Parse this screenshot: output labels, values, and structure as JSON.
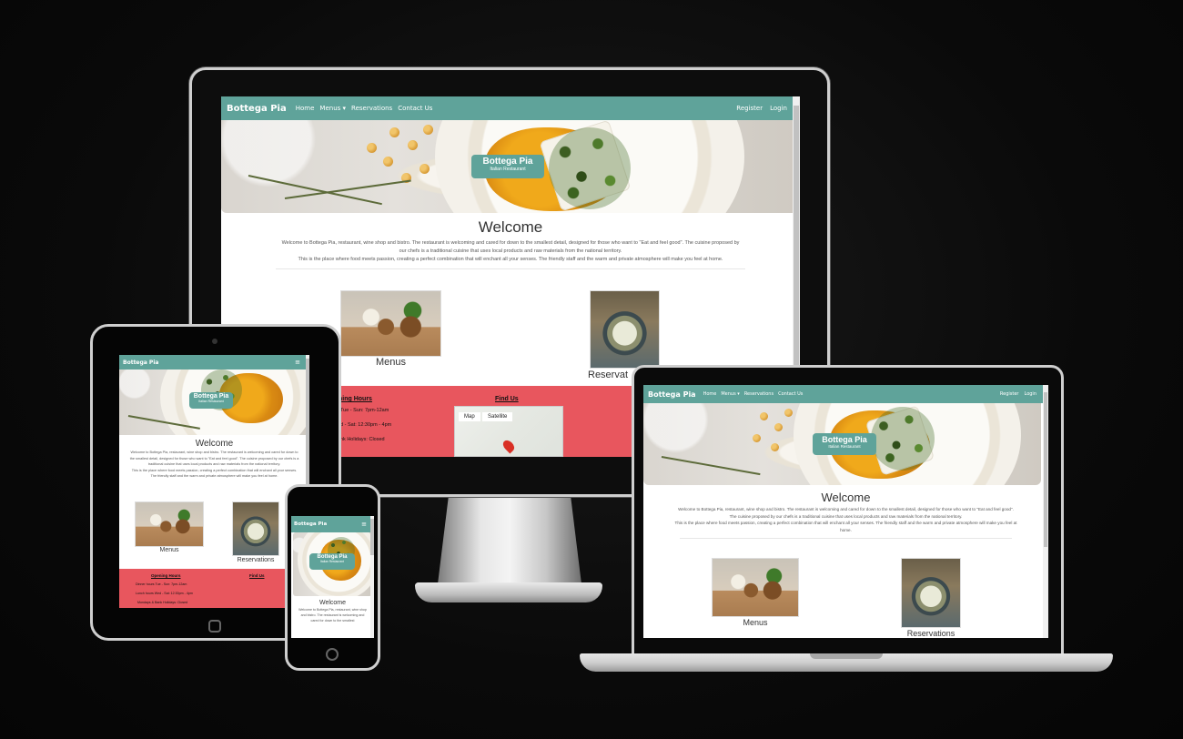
{
  "site": {
    "brand": "Bottega Pia",
    "nav": [
      "Home",
      "Menus",
      "Reservations",
      "Contact Us"
    ],
    "nav_right": [
      "Register",
      "Login"
    ],
    "hero": {
      "title": "Bottega Pia",
      "subtitle": "Italian Restaurant"
    },
    "welcome": "Welcome",
    "intro_1": "Welcome to Bottega Pia, restaurant, wine shop and bistro. The restaurant is welcoming and cared for down to the smallest detail, designed for those who want to \"Eat and feel good\". The cuisine proposed by our chefs is a traditional cuisine that uses local products and raw materials from the national territory.",
    "intro_2": "This is the place where food meets passion, creating a perfect combination that will enchant all your senses. The friendly staff and the warm and private atmosphere will make you feel at home.",
    "cards": {
      "menus": "Menus",
      "reservations": "Reservations",
      "reservations_cut": "Reservat"
    },
    "footer": {
      "opening_hours": "Opening Hours",
      "opening_hours_cut": "ning Hours",
      "hours": [
        "Dinner hours Tue - Sun: 7pm-12am",
        "Lunch hours Wed - Sat: 12:30pm - 4pm",
        "Mondays & Bank Holidays: Closed"
      ],
      "hours_cut": [
        "Tue - Sun: 7pm-12am",
        "d - Sat: 12:30pm - 4pm",
        "nk Holidays: Closed"
      ],
      "find_us": "Find Us",
      "map_tabs": [
        "Map",
        "Satellite"
      ]
    },
    "phone_intro": "Welcome to Bottega Pia, restaurant, wine shop and bistro. The restaurant is welcoming and cared for down to the smallest",
    "colors": {
      "primary": "#5fa39a",
      "footer": "#e8565e"
    },
    "icons": {
      "menu_toggle": "hamburger-icon",
      "dropdown": "caret-down-icon",
      "map_pin": "map-pin-icon"
    }
  }
}
